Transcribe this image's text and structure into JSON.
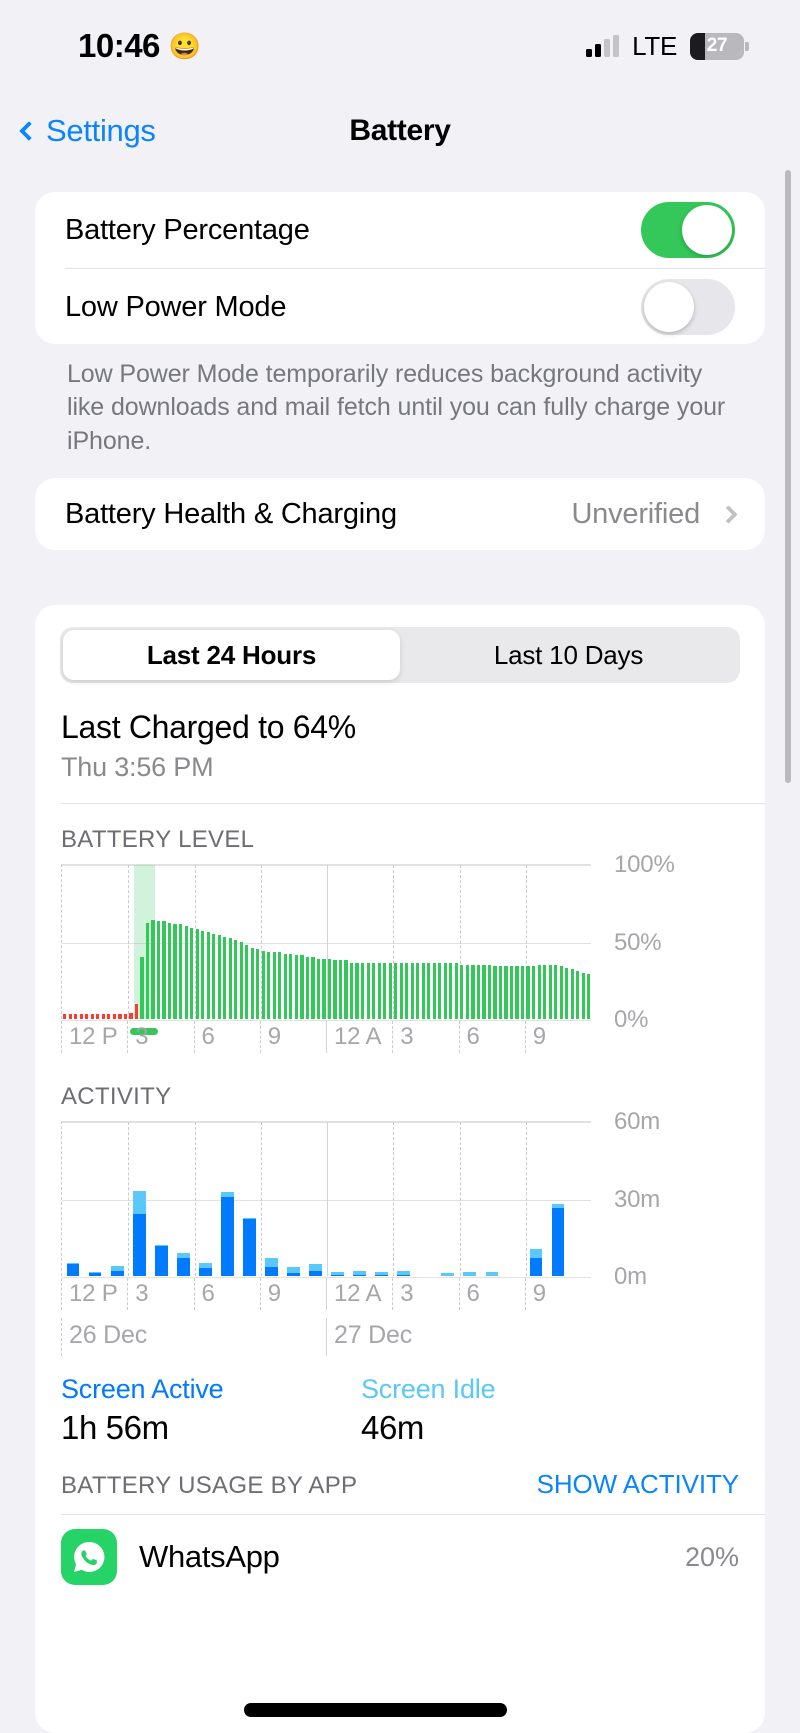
{
  "status_bar": {
    "time": "10:46",
    "emoji": "😀",
    "carrier": "LTE",
    "battery_percent": "27",
    "signal_icon": "signal-bars-icon",
    "battery_icon": "battery-icon"
  },
  "nav": {
    "back_label": "Settings",
    "title": "Battery",
    "back_icon": "chevron-left-icon"
  },
  "settings": {
    "battery_percentage": {
      "label": "Battery Percentage",
      "state": "on"
    },
    "low_power_mode": {
      "label": "Low Power Mode",
      "state": "off"
    },
    "footnote": "Low Power Mode temporarily reduces background activity like downloads and mail fetch until you can fully charge your iPhone.",
    "battery_health": {
      "label": "Battery Health & Charging",
      "value": "Unverified",
      "disclosure_icon": "chevron-right-icon"
    }
  },
  "usage_card": {
    "segments": [
      {
        "label": "Last 24 Hours",
        "selected": true
      },
      {
        "label": "Last 10 Days",
        "selected": false
      }
    ],
    "last_charged_title": "Last Charged to 64%",
    "last_charged_sub": "Thu 3:56 PM",
    "battery_level_header": "BATTERY LEVEL",
    "activity_header": "ACTIVITY",
    "legend": [
      {
        "name": "Screen Active",
        "value": "1h 56m",
        "color": "#007aff"
      },
      {
        "name": "Screen Idle",
        "value": "46m",
        "color": "#5ac8fa"
      }
    ],
    "usage_by_app_header": "BATTERY USAGE BY APP",
    "show_activity_link": "SHOW ACTIVITY",
    "apps": [
      {
        "name": "WhatsApp",
        "percent": "20%",
        "icon": "whatsapp-icon"
      }
    ]
  },
  "chart_data": [
    {
      "type": "bar",
      "title": "BATTERY LEVEL",
      "xlabel": "",
      "ylabel": "",
      "ylim": [
        0,
        100
      ],
      "yticks": [
        0,
        50,
        100
      ],
      "ytick_labels": [
        "0%",
        "50%",
        "100%"
      ],
      "xticks": [
        "12 P",
        "3",
        "6",
        "9",
        "12 A",
        "3",
        "6",
        "9"
      ],
      "grid": true,
      "legend_position": "none",
      "series": [
        {
          "name": "Battery Level",
          "color": "#34c759",
          "values": [
            3,
            3,
            3,
            3,
            3,
            3,
            3,
            3,
            3,
            3,
            3,
            3,
            4,
            10,
            40,
            62,
            64,
            63,
            63,
            62,
            61,
            61,
            60,
            59,
            58,
            57,
            56,
            55,
            54,
            53,
            52,
            51,
            50,
            48,
            46,
            45,
            44,
            43,
            43,
            43,
            42,
            42,
            41,
            41,
            40,
            40,
            39,
            39,
            39,
            38,
            38,
            38,
            36,
            36,
            36,
            36,
            36,
            36,
            36,
            36,
            36,
            36,
            36,
            36,
            36,
            36,
            36,
            36,
            36,
            36,
            36,
            36,
            35,
            35,
            35,
            35,
            35,
            35,
            34,
            34,
            34,
            34,
            34,
            34,
            34,
            34,
            35,
            35,
            35,
            35,
            34,
            33,
            32,
            31,
            30,
            29
          ]
        },
        {
          "name": "Charging (red/low)",
          "color": "#ff3b30",
          "values": [
            3,
            3,
            3,
            3,
            3,
            3,
            3,
            3,
            3,
            3,
            3,
            3,
            4,
            10,
            0,
            0,
            0,
            0,
            0,
            0,
            0,
            0,
            0,
            0,
            0,
            0,
            0,
            0,
            0,
            0,
            0,
            0,
            0,
            0,
            0,
            0,
            0,
            0,
            0,
            0,
            0,
            0,
            0,
            0,
            0,
            0,
            0,
            0,
            0,
            0,
            0,
            0,
            0,
            0,
            0,
            0,
            0,
            0,
            0,
            0,
            0,
            0,
            0,
            0,
            0,
            0,
            0,
            0,
            0,
            0,
            0,
            0,
            0,
            0,
            0,
            0,
            0,
            0,
            0,
            0,
            0,
            0,
            0,
            0,
            0,
            0,
            0,
            0,
            0,
            0,
            0,
            0,
            0,
            0,
            0,
            0
          ]
        }
      ],
      "annotations": [
        {
          "type": "charging_band",
          "label": "charging period",
          "x_start_fraction": 0.135,
          "x_end_fraction": 0.175,
          "color": "#34c759"
        },
        {
          "type": "charging_marker",
          "label": "plugged in",
          "x_fraction": 0.152,
          "color": "#34c759"
        }
      ]
    },
    {
      "type": "bar",
      "title": "ACTIVITY",
      "xlabel": "",
      "ylabel": "",
      "ylim": [
        0,
        60
      ],
      "yticks": [
        0,
        30,
        60
      ],
      "ytick_labels": [
        "0m",
        "30m",
        "60m"
      ],
      "xticks": [
        "12 P",
        "3",
        "6",
        "9",
        "12 A",
        "3",
        "6",
        "9"
      ],
      "day_labels": [
        "26 Dec",
        "27 Dec"
      ],
      "grid": true,
      "stacked": true,
      "legend_position": "below",
      "categories": [
        "12P",
        "1P",
        "2P",
        "3P",
        "4P",
        "5P",
        "6P",
        "7P",
        "8P",
        "9P",
        "10P",
        "11P",
        "12A",
        "1A",
        "2A",
        "3A",
        "4A",
        "5A",
        "6A",
        "7A",
        "8A",
        "9A",
        "10A",
        "11A"
      ],
      "series": [
        {
          "name": "Screen Active",
          "color": "#007aff",
          "values": [
            4.5,
            1.0,
            2.0,
            24.0,
            11.5,
            7.0,
            3.0,
            30.5,
            22.0,
            3.5,
            1.0,
            2.0,
            0.5,
            0.5,
            0.5,
            0.5,
            0.0,
            0.0,
            0.0,
            0.0,
            0.0,
            7.0,
            26.5,
            0.0
          ]
        },
        {
          "name": "Screen Idle",
          "color": "#5ac8fa",
          "values": [
            0.5,
            0.5,
            2.0,
            9.0,
            0.5,
            2.0,
            2.0,
            2.0,
            0.5,
            3.5,
            2.5,
            2.5,
            1.0,
            1.5,
            1.0,
            1.5,
            0.0,
            1.0,
            1.5,
            1.5,
            0.0,
            3.5,
            1.5,
            0.0
          ]
        }
      ]
    }
  ]
}
